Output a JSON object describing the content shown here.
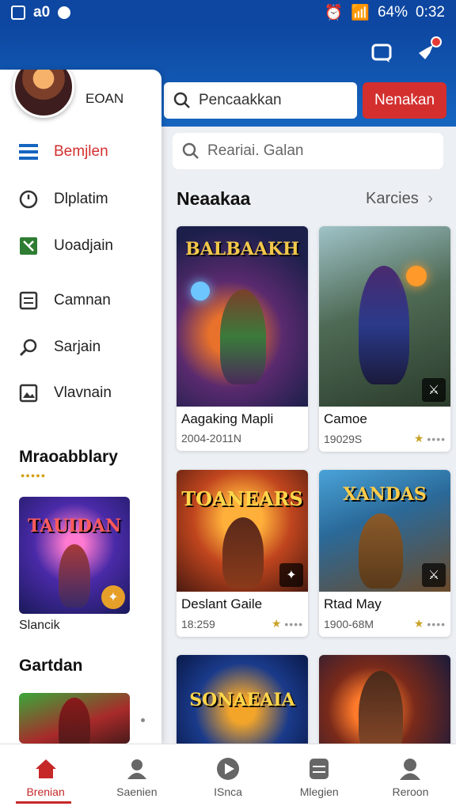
{
  "status_bar": {
    "left_text": "a0",
    "battery": "64%",
    "time": "0:32"
  },
  "header": {
    "search_placeholder": "Pencaakkan",
    "action_button": "Nenakan",
    "icons": [
      "chat-icon",
      "notifications-icon"
    ]
  },
  "drawer": {
    "username": "EOAN",
    "items": [
      {
        "label": "Bemjlen",
        "icon": "menu-icon",
        "active": true
      },
      {
        "label": "Dlplatim",
        "icon": "clock-icon",
        "active": false
      },
      {
        "label": "Uoadjain",
        "icon": "map-icon",
        "active": false
      },
      {
        "label": "Camnan",
        "icon": "list-icon",
        "active": false
      },
      {
        "label": "Sarjain",
        "icon": "search-icon",
        "active": false
      },
      {
        "label": "Vlavnain",
        "icon": "image-icon",
        "active": false
      }
    ],
    "section1_title": "Mraoabblary",
    "section1_card_label": "Slancik",
    "section1_card_art": "TAUIDAN",
    "section2_title": "Gartdan"
  },
  "main": {
    "search_placeholder": "Reariai. Galan",
    "list_title": "Neaakaa",
    "list_more": "Karcies",
    "cards": [
      {
        "title": "Aagaking Mapli",
        "meta": "2004-2011N",
        "art": "BALBAAKH",
        "rating": ""
      },
      {
        "title": "Camoe",
        "meta": "19029S",
        "art": "",
        "rating": "★"
      },
      {
        "title": "Deslant Gaile",
        "meta": "18:259",
        "art": "TOANEARS",
        "rating": "★"
      },
      {
        "title": "Rtad May",
        "meta": "1900-68M",
        "art": "XANDAS",
        "rating": "★"
      },
      {
        "title": "",
        "meta": "",
        "art": "SONAEAIA",
        "rating": ""
      },
      {
        "title": "",
        "meta": "",
        "art": "",
        "rating": ""
      }
    ]
  },
  "bottom_nav": [
    {
      "label": "Brenian",
      "icon": "home-icon",
      "active": true
    },
    {
      "label": "Saenien",
      "icon": "person-icon",
      "active": false
    },
    {
      "label": "ISnca",
      "icon": "play-icon",
      "active": false
    },
    {
      "label": "Mlegien",
      "icon": "storage-icon",
      "active": false
    },
    {
      "label": "Reroon",
      "icon": "profile-icon",
      "active": false
    }
  ],
  "colors": {
    "primary": "#0d47a1",
    "accent": "#d32f2f",
    "star": "#c9a227"
  }
}
